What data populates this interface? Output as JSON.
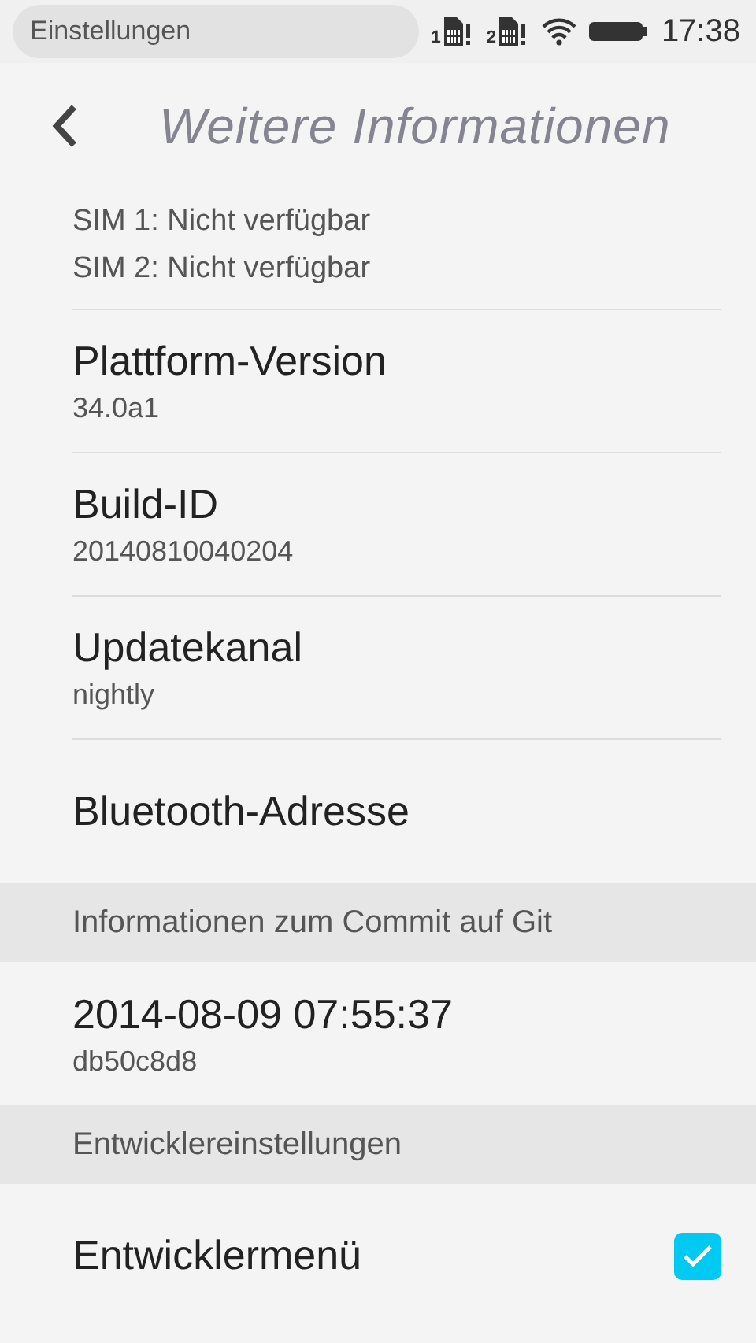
{
  "status_bar": {
    "app_name": "Einstellungen",
    "sim_slots": [
      {
        "label": "1"
      },
      {
        "label": "2"
      }
    ],
    "time": "17:38"
  },
  "header": {
    "title": "Weitere Informationen"
  },
  "rows": [
    {
      "kind": "lines",
      "lines": [
        "SIM 1: Nicht verfügbar",
        "SIM 2: Nicht verfügbar"
      ]
    },
    {
      "kind": "item",
      "title": "Plattform-Version",
      "value": "34.0a1"
    },
    {
      "kind": "item",
      "title": "Build-ID",
      "value": "20140810040204"
    },
    {
      "kind": "item",
      "title": "Updatekanal",
      "value": "nightly"
    },
    {
      "kind": "item",
      "title": "Bluetooth-Adresse"
    },
    {
      "kind": "section",
      "title": "Informationen zum Commit auf Git"
    },
    {
      "kind": "item",
      "title": "2014-08-09 07:55:37",
      "value": "db50c8d8"
    },
    {
      "kind": "section",
      "title": "Entwicklereinstellungen"
    },
    {
      "kind": "checkbox",
      "title": "Entwicklermenü",
      "checked": true
    }
  ]
}
